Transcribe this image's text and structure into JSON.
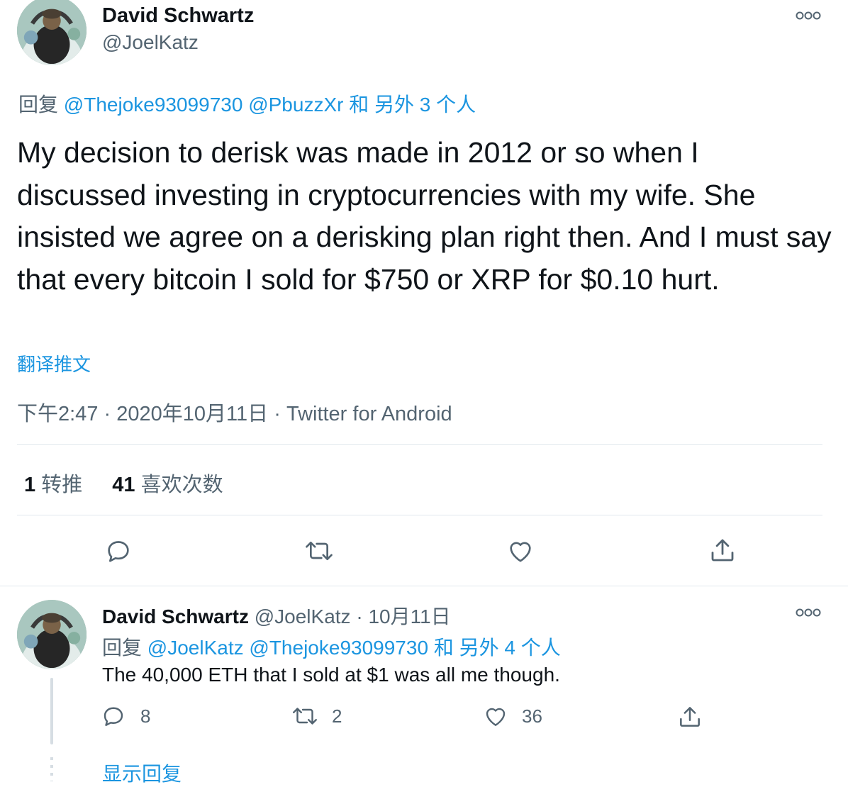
{
  "main_tweet": {
    "author_name": "David Schwartz",
    "author_handle": "@JoelKatz",
    "more_icon": "more-horizontal-icon",
    "reply_prefix": "回复",
    "reply_to_1": "@Thejoke93099730",
    "reply_to_2": "@PbuzzXr",
    "reply_and": "和",
    "reply_others": "另外 3 个人",
    "text": "My decision to derisk was made in 2012 or so when I discussed investing in cryptocurrencies with my wife. She insisted we agree on a derisking plan right then. And I must say that every bitcoin I sold for $750 or XRP for $0.10 hurt.",
    "translate": "翻译推文",
    "time": "下午2:47",
    "date": "2020年10月11日",
    "source": "Twitter for Android",
    "separator": "·",
    "retweets_count": "1",
    "retweets_label": "转推",
    "likes_count": "41",
    "likes_label": "喜欢次数"
  },
  "reply_tweet": {
    "author_name": "David Schwartz",
    "author_handle": "@JoelKatz",
    "separator": "·",
    "date": "10月11日",
    "reply_prefix": "回复",
    "reply_to_1": "@JoelKatz",
    "reply_to_2": "@Thejoke93099730",
    "reply_and": "和",
    "reply_others": "另外 4 个人",
    "text": "The 40,000 ETH that I sold at $1 was all me though.",
    "reply_count": "8",
    "retweet_count": "2",
    "like_count": "36"
  },
  "show_replies": "显示回复",
  "colors": {
    "link": "#1b95e0",
    "secondary": "#536471",
    "divider": "#e1e8ed"
  }
}
